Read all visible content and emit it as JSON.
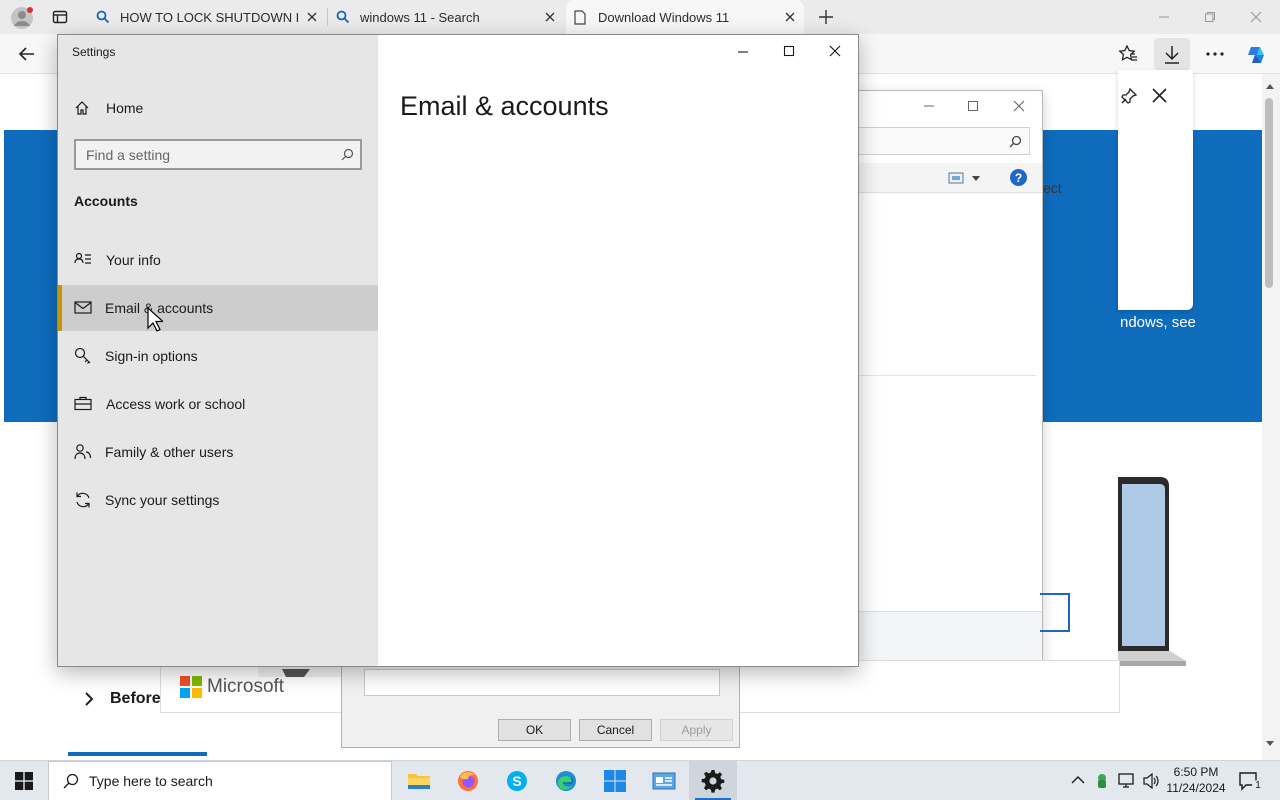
{
  "browser": {
    "tabs": [
      {
        "title": "HOW TO LOCK SHUTDOWN BUTTON",
        "icon": "search-icon"
      },
      {
        "title": "windows 11 - Search",
        "icon": "search-icon"
      },
      {
        "title": "Download Windows 11",
        "icon": "page-icon"
      }
    ]
  },
  "background_page": {
    "hero_text": "ndows, see",
    "before_label": "Before",
    "microsoft_logo_text": "Microsoft",
    "partial_label": "ect"
  },
  "background_dialog": {
    "ok_label": "OK",
    "cancel_label": "Cancel",
    "apply_label": "Apply"
  },
  "settings": {
    "window_title": "Settings",
    "home_label": "Home",
    "search_placeholder": "Find a setting",
    "section_title": "Accounts",
    "nav_items": [
      {
        "label": "Your info",
        "icon": "person-card-icon"
      },
      {
        "label": "Email & accounts",
        "icon": "mail-icon",
        "selected": true
      },
      {
        "label": "Sign-in options",
        "icon": "key-icon"
      },
      {
        "label": "Access work or school",
        "icon": "briefcase-icon"
      },
      {
        "label": "Family & other users",
        "icon": "people-icon"
      },
      {
        "label": "Sync your settings",
        "icon": "sync-icon"
      }
    ],
    "page_heading": "Email & accounts",
    "accent_color": "#c99400"
  },
  "taskbar": {
    "search_placeholder": "Type here to search",
    "time": "6:50 PM",
    "date": "11/24/2024",
    "notification_count": "1"
  }
}
